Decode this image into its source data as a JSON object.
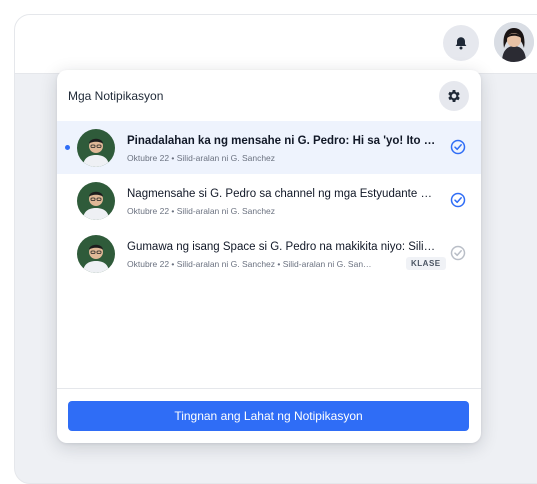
{
  "header": {
    "bell_icon": "bell-icon",
    "avatar_icon": "user-avatar"
  },
  "panel": {
    "title": "Mga Notipikasyon",
    "settings_icon": "gear-icon"
  },
  "notifications": [
    {
      "title": "Pinadalahan ka ng mensahe ni G. Pedro: Hi sa 'yo! Ito ang kan…",
      "meta": "Oktubre 22 • Silid-aralan ni G. Sanchez",
      "unread": true,
      "status": "read-check-blue"
    },
    {
      "title": "Nagmensahe si G. Pedro sa channel ng mga Estyudante at mga…",
      "meta": "Oktubre 22 • Silid-aralan ni G. Sanchez",
      "unread": false,
      "status": "read-check-blue"
    },
    {
      "title": "Gumawa ng isang Space si G. Pedro na makikita niyo: Silid-aralan…",
      "meta": "Oktubre 22 • Silid-aralan ni G. Sanchez • Silid-aralan ni G. San…",
      "tag": "KLASE",
      "unread": false,
      "status": "read-check-gray"
    }
  ],
  "footer": {
    "view_all_label": "Tingnan ang Lahat ng Notipikasyon"
  },
  "colors": {
    "accent": "#2f6df6",
    "unread_bg": "#eef3fd",
    "check_gray": "#b9bec7"
  }
}
